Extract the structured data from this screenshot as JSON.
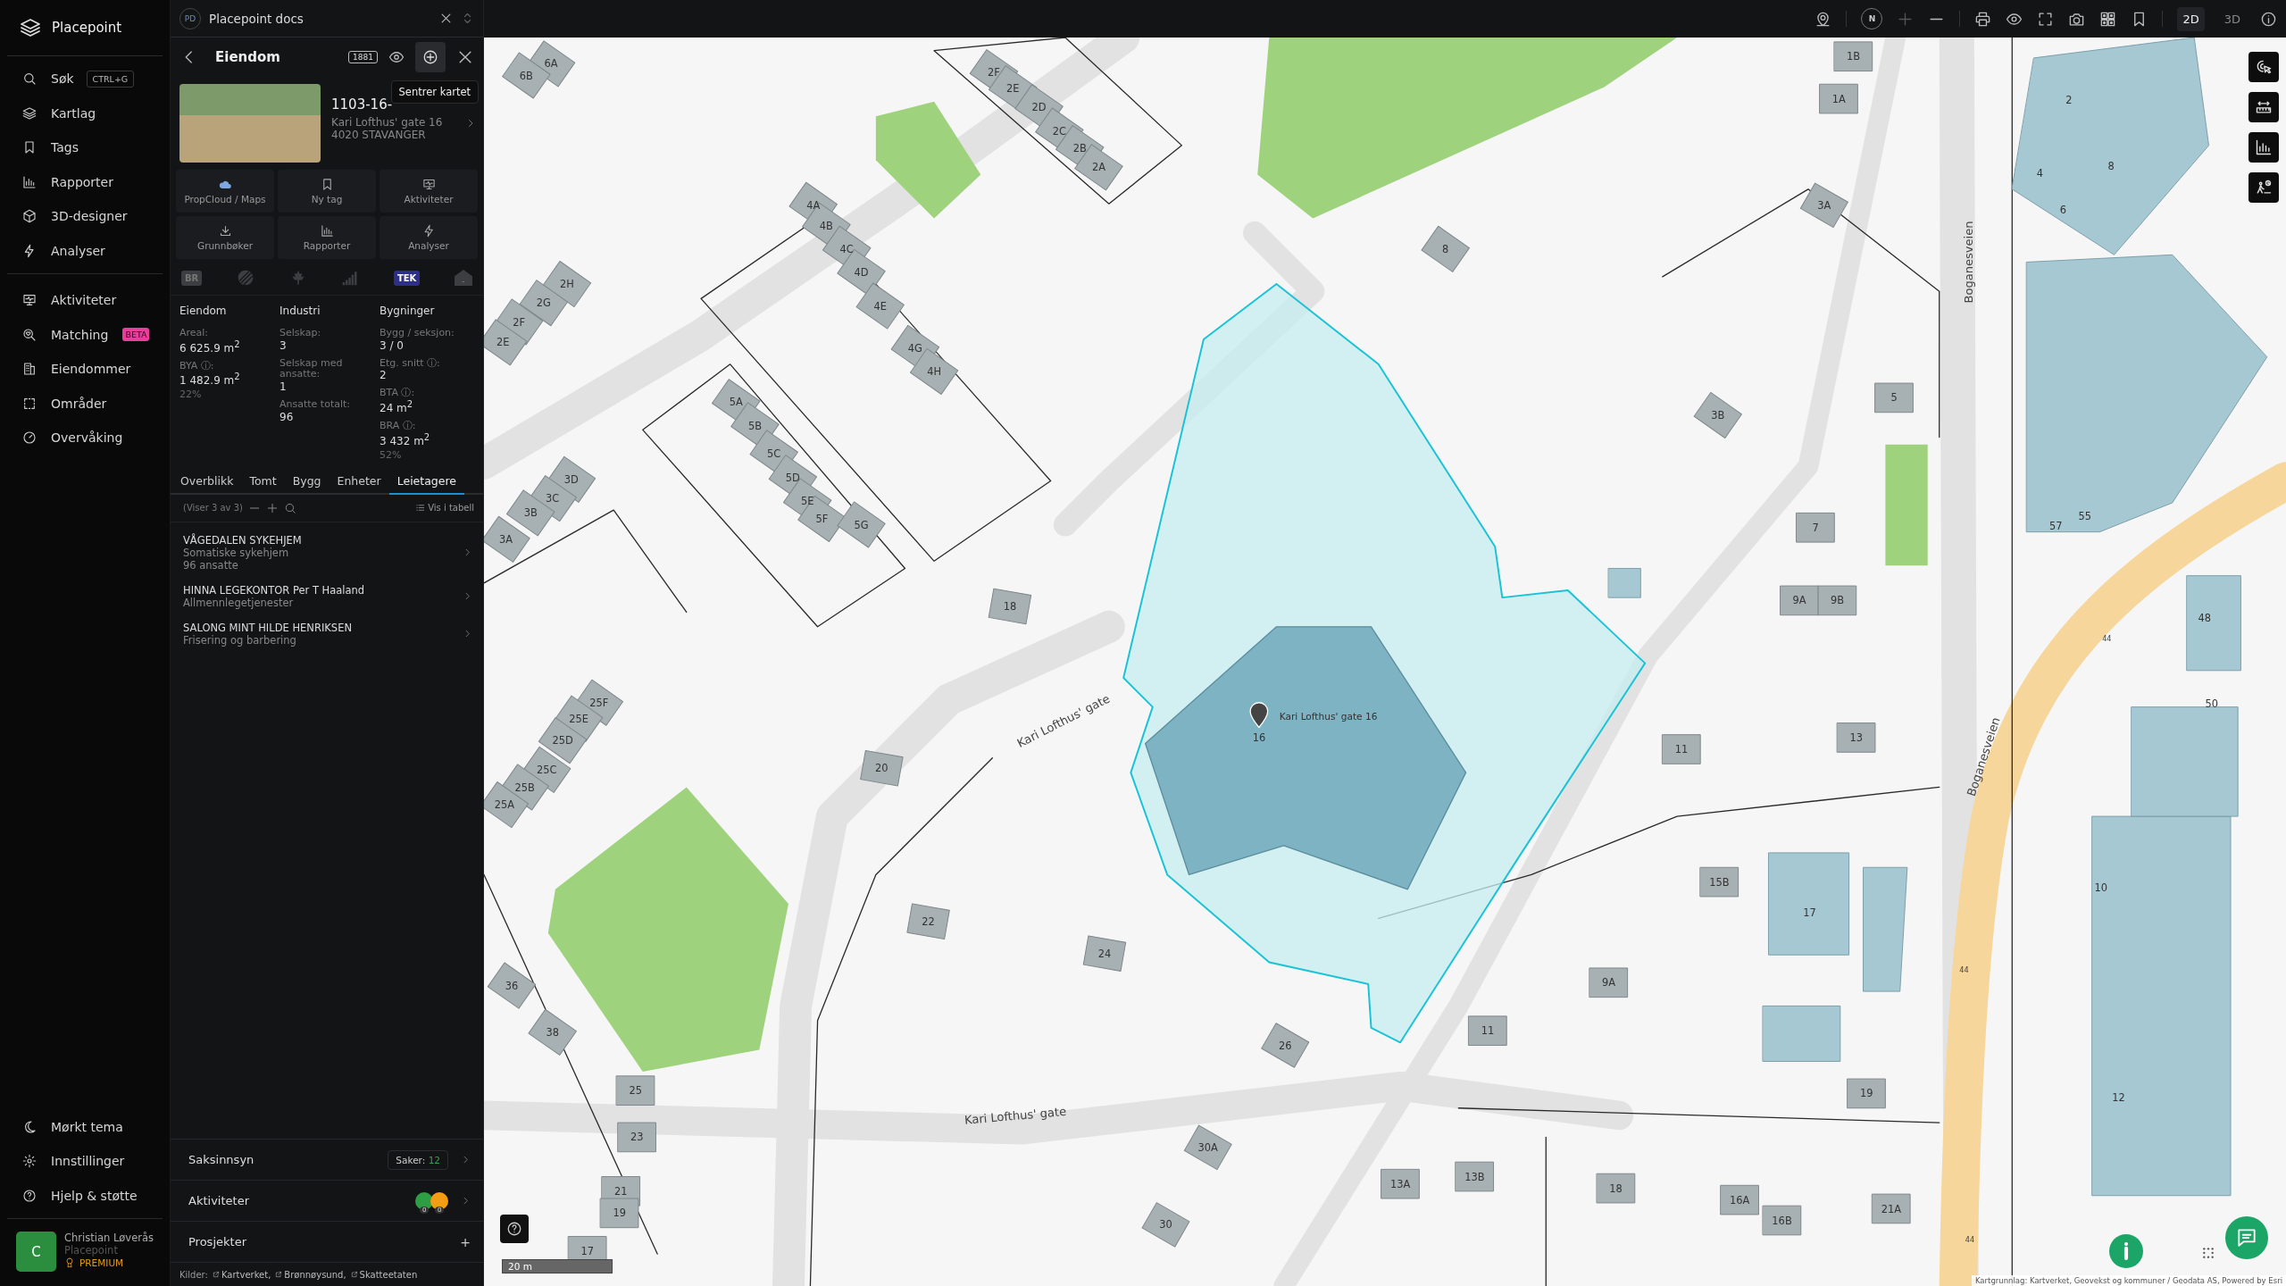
{
  "nav": {
    "brand": "Placepoint",
    "items": [
      {
        "label": "Søk",
        "shortcut": "CTRL+G"
      },
      {
        "label": "Kartlag"
      },
      {
        "label": "Tags"
      },
      {
        "label": "Rapporter"
      },
      {
        "label": "3D-designer"
      },
      {
        "label": "Analyser"
      }
    ],
    "items2": [
      {
        "label": "Aktiviteter"
      },
      {
        "label": "Matching",
        "badge": "BETA"
      },
      {
        "label": "Eiendommer"
      },
      {
        "label": "Områder"
      },
      {
        "label": "Overvåking"
      }
    ],
    "footer_items": [
      {
        "label": "Mørkt tema"
      },
      {
        "label": "Innstillinger"
      },
      {
        "label": "Hjelp & støtte"
      }
    ],
    "user": {
      "initial": "C",
      "name": "Christian Løverås",
      "org": "Placepoint",
      "plan": "PREMIUM"
    }
  },
  "panel": {
    "workspace": {
      "initials": "PD",
      "name": "Placepoint docs"
    },
    "header": {
      "title": "Eiendom",
      "badge": "1881",
      "tooltip": "Sentrer kartet"
    },
    "property": {
      "id": "1103-16-",
      "address": "Kari Lofthus' gate 16",
      "postal": "4020 STAVANGER"
    },
    "actions": [
      "PropCloud / Maps",
      "Ny tag",
      "Aktiviteter",
      "Grunnbøker",
      "Rapporter",
      "Analyser"
    ],
    "sources": [
      {
        "text": "BR",
        "active": false
      },
      {
        "active": false
      },
      {
        "active": false
      },
      {
        "active": false
      },
      {
        "text": "TEK",
        "active": true
      },
      {
        "text": "-",
        "active": false
      }
    ],
    "stats": [
      {
        "title": "Eiendom",
        "fields": [
          {
            "label": "Areal:",
            "value": "6 625.9  m$^{2}$"
          },
          {
            "label": "BYA ⓘ:",
            "value": "1 482.9 m$^{2}$",
            "note": "22%"
          }
        ]
      },
      {
        "title": "Industri",
        "fields": [
          {
            "label": "Selskap:",
            "value": "3"
          },
          {
            "label": "Selskap med ansatte:",
            "value": "1"
          },
          {
            "label": "Ansatte totalt:",
            "value": "96"
          }
        ]
      },
      {
        "title": "Bygninger",
        "fields": [
          {
            "label": "Bygg / seksjon:",
            "value": "3 / 0"
          },
          {
            "label": "Etg. snitt ⓘ:",
            "value": "2"
          },
          {
            "label": "BTA ⓘ:",
            "value": "24  m$^{2}$"
          },
          {
            "label": "BRA ⓘ:",
            "value": "3 432 m$^{2}$",
            "note": "52%"
          }
        ]
      }
    ],
    "tabs": [
      {
        "label": "Overblikk",
        "selected": false
      },
      {
        "label": "Tomt",
        "selected": false
      },
      {
        "label": "Bygg",
        "selected": false
      },
      {
        "label": "Enheter",
        "selected": false
      },
      {
        "label": "Leietagere",
        "selected": true
      }
    ],
    "list_toolbar": {
      "count": "(Viser 3 av 3)",
      "table_link": "Vis i tabell"
    },
    "tenants": [
      {
        "name": "VÅGEDALEN SYKEHJEM",
        "lines": [
          "Somatiske sykehjem",
          "96 ansatte"
        ]
      },
      {
        "name": "HINNA LEGEKONTOR Per T Haaland",
        "lines": [
          "Allmennlegetjenester"
        ]
      },
      {
        "name": "SALONG MINT HILDE HENRIKSEN",
        "lines": [
          "Frisering og barbering"
        ]
      }
    ],
    "sections": [
      {
        "kind": "count",
        "title": "Saksinnsyn",
        "label": "Saker:",
        "count": "12"
      },
      {
        "kind": "activity",
        "title": "Aktiviteter",
        "badges": [
          {
            "color": "#2e9e44",
            "count": "0"
          },
          {
            "color": "#f29d12",
            "count": "0"
          }
        ]
      },
      {
        "kind": "add",
        "title": "Prosjekter",
        "action": "+"
      }
    ],
    "sources_footer": {
      "label": "Kilder:",
      "links": [
        "Kartverket,",
        "Brønnøysund,",
        "Skatteetaten"
      ]
    }
  },
  "map": {
    "compass": "N",
    "modes": [
      {
        "label": "2D",
        "selected": true
      },
      {
        "label": "3D",
        "selected": false
      }
    ],
    "building_labels": [
      "6A",
      "6B",
      "2F",
      "2E",
      "2D",
      "2C",
      "2B",
      "2A",
      "4A",
      "4B",
      "4C",
      "4D",
      "4E",
      "4G",
      "4H",
      "2H",
      "2G",
      "2F",
      "2E",
      "5A",
      "5B",
      "5C",
      "5D",
      "5E",
      "5F",
      "5G",
      "3D",
      "3C",
      "3B",
      "3A",
      "18",
      "20",
      "16",
      "22",
      "24",
      "26",
      "1B",
      "1A",
      "2",
      "4",
      "8",
      "6",
      "8",
      "3A",
      "3B",
      "5",
      "7",
      "9A",
      "9B",
      "57",
      "55",
      "48",
      "50",
      "11",
      "13",
      "15B",
      "17",
      "10",
      "9A",
      "11",
      "19",
      "12",
      "13A",
      "13B",
      "18",
      "16A",
      "16B",
      "21A",
      "30A",
      "30",
      "25F",
      "25E",
      "25D",
      "25C",
      "25B",
      "25A",
      "36",
      "38",
      "25",
      "23",
      "21",
      "19",
      "17"
    ],
    "street_labels": [
      "Kari Lofthus' gate",
      "Kari Lofthus' gate",
      "Boganesveien",
      "Boganesveien"
    ],
    "road_numbers": [
      "44",
      "44",
      "44"
    ],
    "marker_label": "Kari Lofthus' gate 16",
    "scale": "20 m",
    "attribution": "Kartgrunnlag: Kartverket, Geovekst og kommuner / Geodata AS, Powered by Esri"
  }
}
